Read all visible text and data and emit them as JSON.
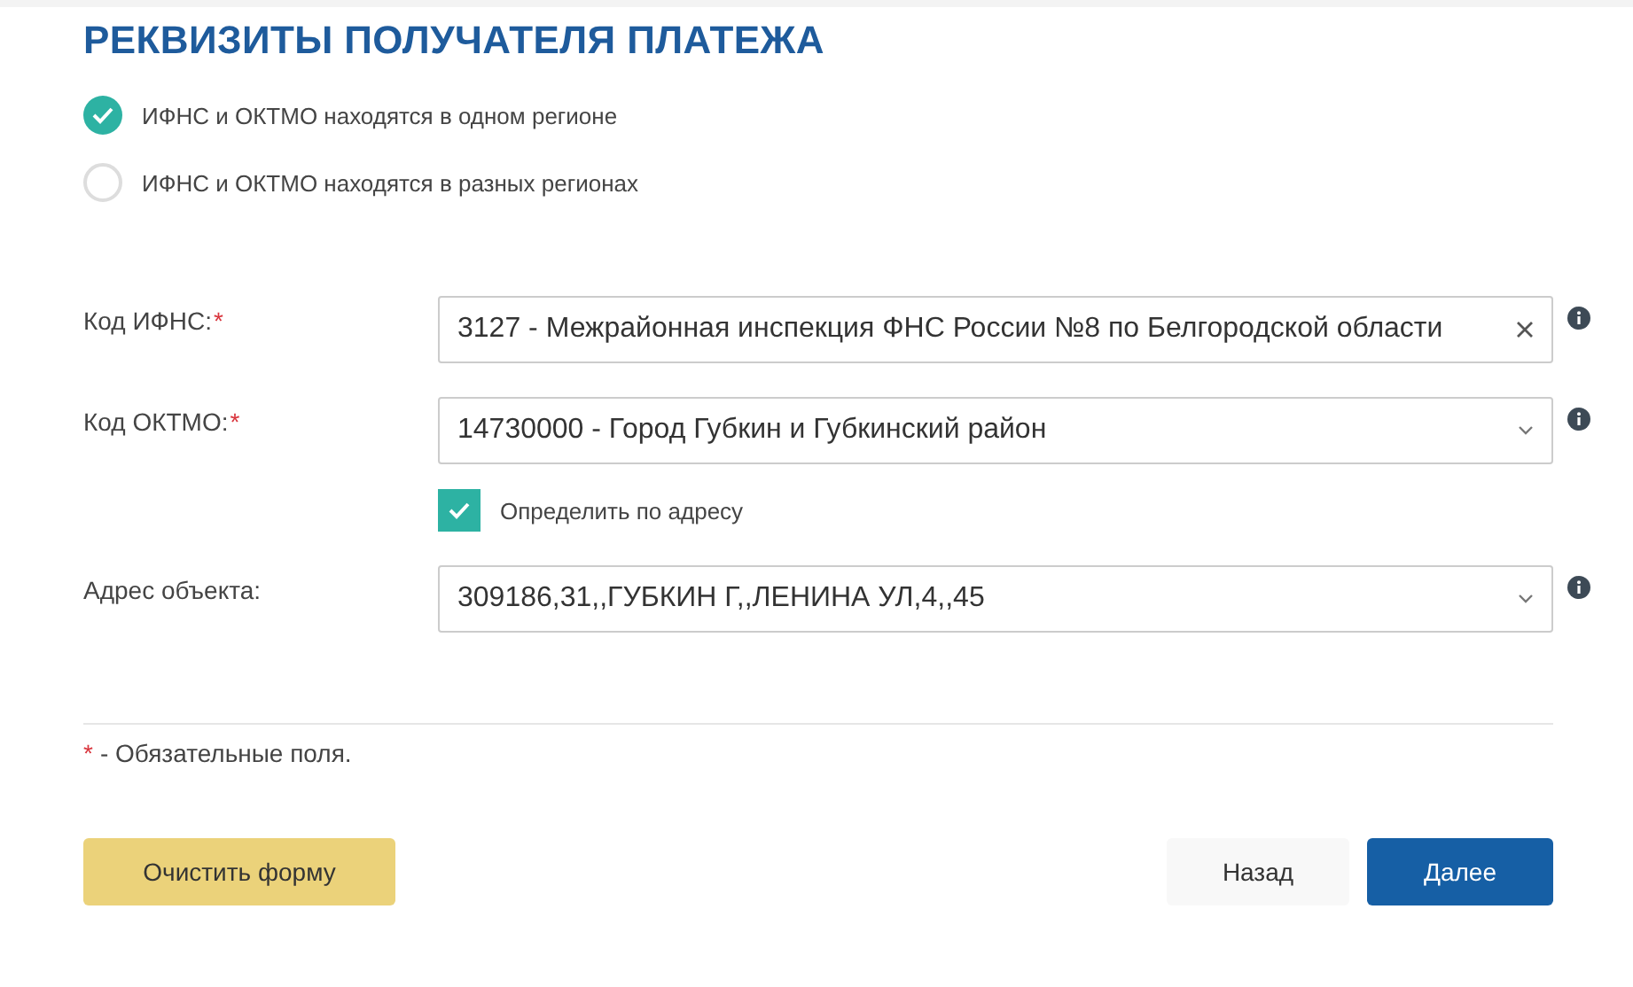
{
  "title": "РЕКВИЗИТЫ ПОЛУЧАТЕЛЯ ПЛАТЕЖА",
  "region_options": [
    {
      "label": "ИФНС и ОКТМО находятся в одном регионе",
      "selected": true
    },
    {
      "label": "ИФНС и ОКТМО находятся в разных регионах",
      "selected": false
    }
  ],
  "fields": [
    {
      "label": "Код ИФНС:",
      "required_mark": "*",
      "value": "3127 - Межрайонная инспекция ФНС России №8 по Белгородской области",
      "kind": "clearable"
    },
    {
      "label": "Код ОКТМО:",
      "required_mark": "*",
      "value": "14730000 - Город Губкин и Губкинский район",
      "kind": "dropdown",
      "checkbox": {
        "label": "Определить по адресу",
        "checked": true
      }
    },
    {
      "label": "Адрес объекта:",
      "value": "309186,31,,ГУБКИН Г,,ЛЕНИНА УЛ,4,,45",
      "kind": "dropdown"
    }
  ],
  "note": {
    "mark": "*",
    "text": "- Обязательные поля."
  },
  "buttons": [
    {
      "label": "Очистить форму",
      "kind": "warning"
    },
    {
      "label": "Назад",
      "kind": "secondary"
    },
    {
      "label": "Далее",
      "kind": "primary"
    }
  ]
}
